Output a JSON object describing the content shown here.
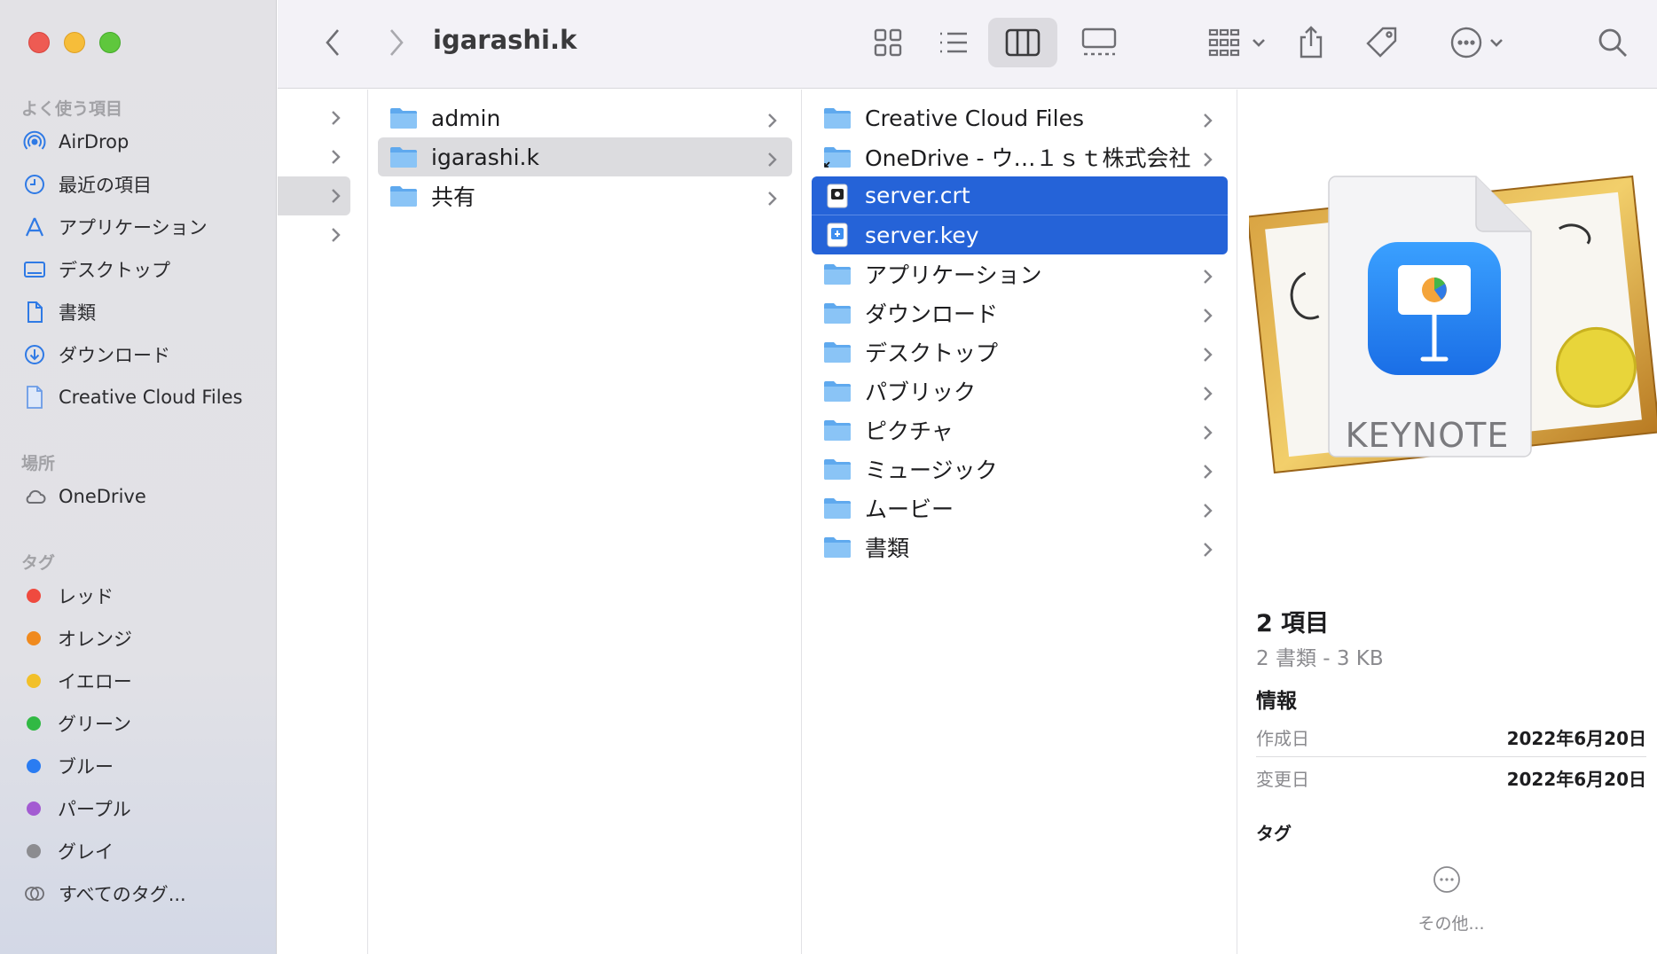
{
  "window": {
    "title": "igarashi.k"
  },
  "sidebar": {
    "favorites_header": "よく使う項目",
    "favorites": [
      {
        "label": "AirDrop",
        "icon": "airdrop-icon"
      },
      {
        "label": "最近の項目",
        "icon": "clock-icon"
      },
      {
        "label": "アプリケーション",
        "icon": "applications-icon"
      },
      {
        "label": "デスクトップ",
        "icon": "desktop-icon"
      },
      {
        "label": "書類",
        "icon": "document-icon"
      },
      {
        "label": "ダウンロード",
        "icon": "download-icon"
      },
      {
        "label": "Creative Cloud Files",
        "icon": "file-icon"
      }
    ],
    "locations_header": "場所",
    "locations": [
      {
        "label": "OneDrive",
        "icon": "cloud-icon"
      }
    ],
    "tags_header": "タグ",
    "tags": [
      {
        "label": "レッド",
        "color": "#ef4a3f"
      },
      {
        "label": "オレンジ",
        "color": "#f08a1e"
      },
      {
        "label": "イエロー",
        "color": "#f2c029"
      },
      {
        "label": "グリーン",
        "color": "#31b944"
      },
      {
        "label": "ブルー",
        "color": "#2a7cf2"
      },
      {
        "label": "パープル",
        "color": "#a35bd2"
      },
      {
        "label": "グレイ",
        "color": "#8c8c90"
      }
    ],
    "all_tags": "すべてのタグ..."
  },
  "columns": {
    "col2": [
      {
        "name": "admin",
        "type": "folder",
        "chevron": true
      },
      {
        "name": "igarashi.k",
        "type": "folder",
        "chevron": true,
        "selected": true
      },
      {
        "name": "共有",
        "type": "folder",
        "chevron": true
      }
    ],
    "col3": [
      {
        "name": "Creative Cloud Files",
        "type": "folder",
        "chevron": true
      },
      {
        "name": "OneDrive - ウ…１ｓｔ株式会社",
        "type": "folder-alias",
        "chevron": true
      },
      {
        "name": "server.crt",
        "type": "certificate",
        "chevron": false,
        "selected": true
      },
      {
        "name": "server.key",
        "type": "key",
        "chevron": false,
        "selected": true
      },
      {
        "name": "アプリケーション",
        "type": "folder",
        "chevron": true
      },
      {
        "name": "ダウンロード",
        "type": "folder",
        "chevron": true
      },
      {
        "name": "デスクトップ",
        "type": "folder",
        "chevron": true
      },
      {
        "name": "パブリック",
        "type": "folder",
        "chevron": true
      },
      {
        "name": "ピクチャ",
        "type": "folder",
        "chevron": true
      },
      {
        "name": "ミュージック",
        "type": "folder",
        "chevron": true
      },
      {
        "name": "ムービー",
        "type": "folder",
        "chevron": true
      },
      {
        "name": "書類",
        "type": "folder",
        "chevron": true
      }
    ]
  },
  "preview": {
    "icon_label": "KEYNOTE",
    "title": "2 項目",
    "subtitle": "2 書類 - 3 KB",
    "info_header": "情報",
    "created_label": "作成日",
    "created_value": "2022年6月20日",
    "modified_label": "変更日",
    "modified_value": "2022年6月20日",
    "tags_header": "タグ",
    "more_label": "その他..."
  }
}
